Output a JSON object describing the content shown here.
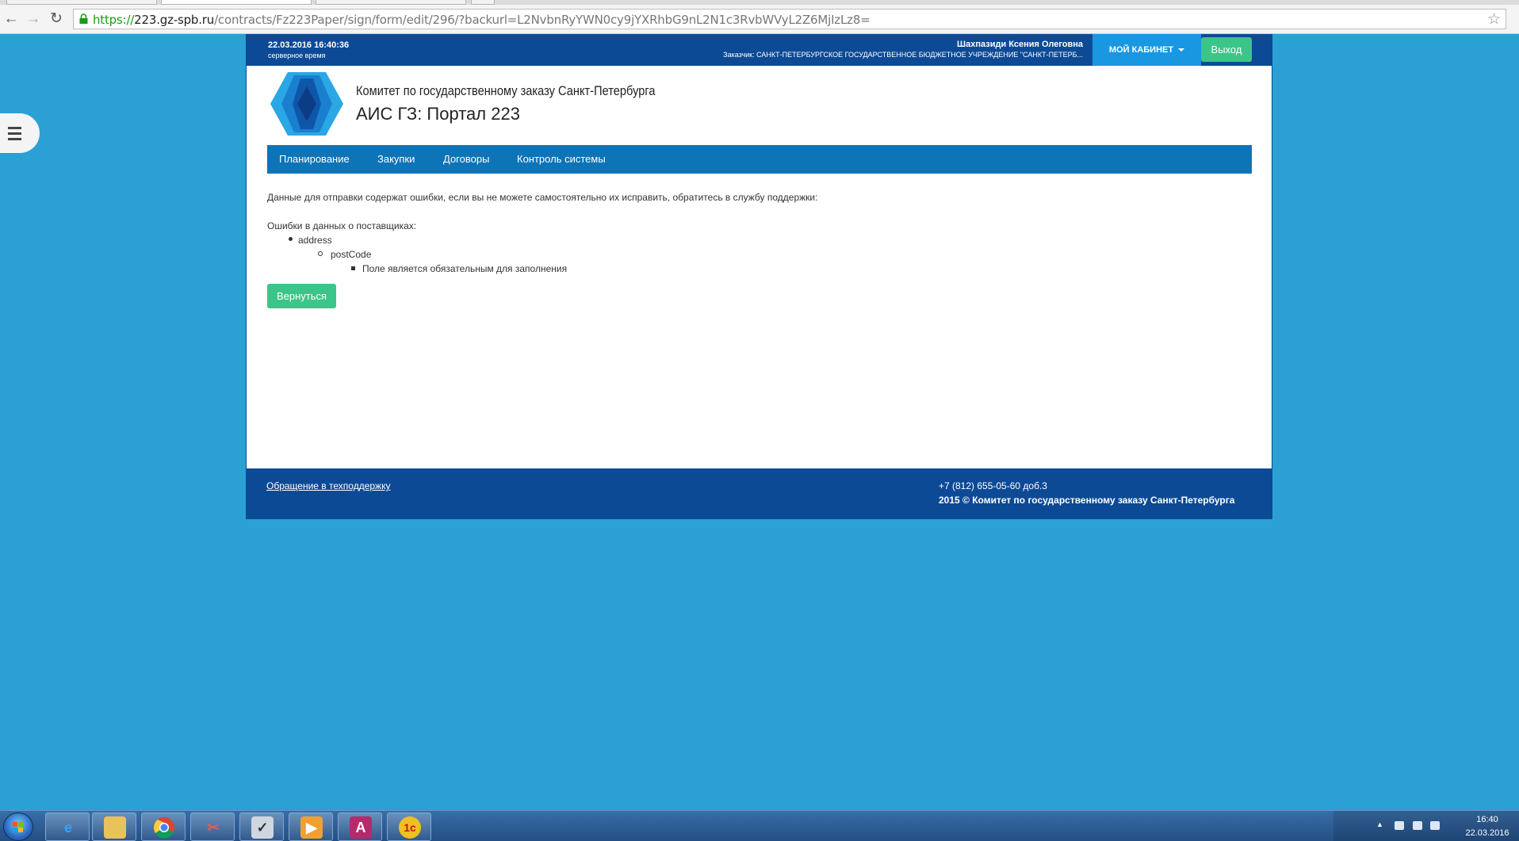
{
  "browser": {
    "url_scheme": "https://",
    "url_host": "223.gz-spb.ru",
    "url_path": "/contracts/Fz223Paper/sign/form/edit/296/?backurl=L2NvbnRyYWN0cy9jYXRhbG9nL2N1c3RvbWVyL2Z6MjIzLz8="
  },
  "header": {
    "server_time": "22.03.2016 16:40:36",
    "server_time_label": "серверное время",
    "user_name": "Шахпазиди Ксения Олеговна",
    "customer": "Заказчик: САНКТ-ПЕТЕРБУРГСКОЕ ГОСУДАРСТВЕННОЕ БЮДЖЕТНОЕ УЧРЕЖДЕНИЕ \"САНКТ-ПЕТЕРБ...",
    "cabinet_label": "МОЙ КАБИНЕТ",
    "logout_label": "Выход"
  },
  "brand": {
    "org_title": "Комитет по государственному заказу Санкт-Петербурга",
    "portal_title": "АИС ГЗ: Портал 223"
  },
  "nav": {
    "items": [
      "Планирование",
      "Закупки",
      "Договоры",
      "Контроль системы"
    ]
  },
  "content": {
    "message": "Данные для отправки содержат ошибки, если вы не можете самостоятельно их исправить, обратитесь в службу поддержки:",
    "errors_title": "Ошибки в данных о поставщиках:",
    "level1": "address",
    "level2": "postCode",
    "level3": "Поле является обязательным для заполнения",
    "back_label": "Вернуться"
  },
  "footer": {
    "support_link": "Обращение в техподдержку",
    "phone": "+7 (812) 655-05-60 доб.3",
    "copyright": "2015 © Комитет по государственному заказу Санкт-Петербурга"
  },
  "taskbar": {
    "time": "16:40",
    "date": "22.03.2016",
    "apps": [
      "internet-explorer-icon",
      "file-explorer-icon",
      "chrome-icon",
      "snipping-tool-icon",
      "crypto-tool-icon",
      "media-player-icon",
      "access-icon",
      "1c-icon"
    ]
  },
  "colors": {
    "background": "#2aa0d5",
    "topbar": "#0d4a96",
    "nav": "#0d74b8",
    "cabinet": "#1997e0",
    "accent_green": "#3cc588"
  }
}
